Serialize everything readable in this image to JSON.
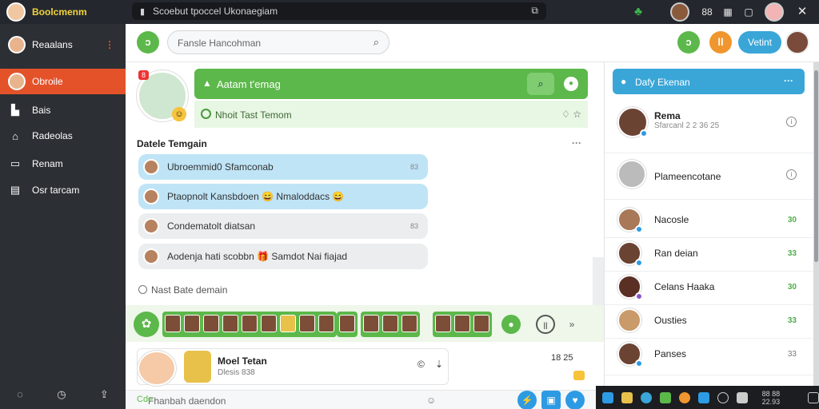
{
  "app": {
    "title": "Boolcmenm"
  },
  "address": {
    "text": "Scoebut tpoccel Ukonaegiam"
  },
  "topbar": {
    "menu_label": "88 fa"
  },
  "sidebar": {
    "profile": "Reaalans",
    "items": [
      {
        "label": "Obroile"
      },
      {
        "label": "Bais"
      },
      {
        "label": "Radeolas"
      },
      {
        "label": "Renam"
      },
      {
        "label": "Osr tarcam"
      }
    ]
  },
  "search": {
    "placeholder": "Fansle Hancohman"
  },
  "header": {
    "button_left": "ↄ",
    "button_green": "ↄ",
    "button_orange": "ll",
    "pill_label": "Vetint"
  },
  "banner": {
    "title": "Aatam t'emag",
    "subtitle": "Nhoit Tast Temom",
    "hero_badge": "8"
  },
  "chats": {
    "section_title": "Datele Temgain",
    "messages": [
      {
        "text": "Ubroemmid0 Sfamconab",
        "tag": "83"
      },
      {
        "text": "Ptaopnolt Kansbdoen 😄 Nmaloddacs 😄",
        "tag": ""
      },
      {
        "text": "Condematolt diatsan",
        "tag": "83"
      },
      {
        "text": "Aodenja hati scobbn 🎁 Samdot Nai fiajad",
        "tag": ""
      }
    ],
    "footer_note": "Nast Bate demain"
  },
  "card": {
    "name": "Moel Tetan",
    "sub": "Dlesis 838",
    "meta": "18 25"
  },
  "compose": {
    "label": "Cde",
    "text": "Fhanbah daendon"
  },
  "right_panel": {
    "title": "Dafy Ekenan",
    "contacts": [
      {
        "name": "Rema",
        "sub": "Sfarcanl 2 2 36 25",
        "meta": ""
      },
      {
        "name": "Plameencotane",
        "sub": "",
        "meta": ""
      },
      {
        "name": "Nacosle",
        "sub": "",
        "meta": "30"
      },
      {
        "name": "Ran deian",
        "sub": "",
        "meta": "33"
      },
      {
        "name": "Celans Haaka",
        "sub": "",
        "meta": "30"
      },
      {
        "name": "Ousties",
        "sub": "",
        "meta": "33"
      },
      {
        "name": "Panses",
        "sub": "",
        "meta": "33"
      }
    ]
  },
  "taskbar": {
    "clock": "88 88\n22.93"
  },
  "colors": {
    "accent_orange": "#e4522a",
    "accent_green": "#5cb84a",
    "accent_blue": "#3aa6d8",
    "sidebar_bg": "#2c2f34"
  }
}
